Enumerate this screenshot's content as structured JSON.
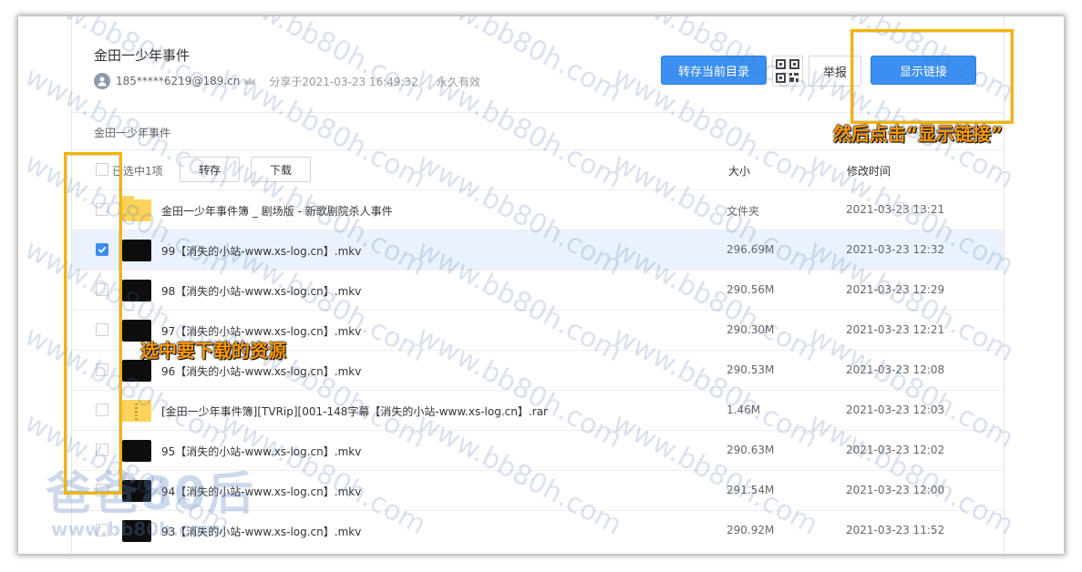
{
  "share": {
    "title": "金田一少年事件",
    "user": "185*****6219@189.cn",
    "shared_at": "分享于2021-03-23 16:49:32",
    "expire": "永久有效"
  },
  "actions": {
    "save_label": "转存当前目录",
    "report_label": "举报",
    "show_link_label": "显示链接"
  },
  "breadcrumb": "金田一少年事件",
  "table": {
    "selected_count": "已选中1项",
    "save_btn": "转存",
    "download_btn": "下载",
    "col_size": "大小",
    "col_time": "修改时间"
  },
  "rows": [
    {
      "type": "folder",
      "name": "金田一少年事件簿 _ 剧场版 - 新歌剧院杀人事件",
      "size": "文件夹",
      "time": "2021-03-23 13:21",
      "checked": false
    },
    {
      "type": "video",
      "name": "99【消失的小站-www.xs-log.cn】.mkv",
      "size": "296.69M",
      "time": "2021-03-23 12:32",
      "checked": true
    },
    {
      "type": "video",
      "name": "98【消失的小站-www.xs-log.cn】.mkv",
      "size": "290.56M",
      "time": "2021-03-23 12:29",
      "checked": false
    },
    {
      "type": "video",
      "name": "97【消失的小站-www.xs-log.cn】.mkv",
      "size": "290.30M",
      "time": "2021-03-23 12:21",
      "checked": false
    },
    {
      "type": "video",
      "name": "96【消失的小站-www.xs-log.cn】.mkv",
      "size": "290.53M",
      "time": "2021-03-23 12:08",
      "checked": false
    },
    {
      "type": "zip",
      "name": "[金田一少年事件簿][TVRip][001-148字幕【消失的小站-www.xs-log.cn】.rar",
      "size": "1.46M",
      "time": "2021-03-23 12:03",
      "checked": false
    },
    {
      "type": "video",
      "name": "95【消失的小站-www.xs-log.cn】.mkv",
      "size": "290.63M",
      "time": "2021-03-23 12:02",
      "checked": false
    },
    {
      "type": "video",
      "name": "94【消失的小站-www.xs-log.cn】.mkv",
      "size": "291.54M",
      "time": "2021-03-23 12:00",
      "checked": false
    },
    {
      "type": "video",
      "name": "93【消失的小站-www.xs-log.cn】.mkv",
      "size": "290.92M",
      "time": "2021-03-23 11:52",
      "checked": false
    }
  ],
  "annotations": {
    "show_link": "然后点击“显示链接”",
    "select": "选中要下载的资源"
  },
  "watermark": {
    "text": "www.bb80h.com",
    "logo": "爸爸80后",
    "logo_sub": "www.bb80h.com"
  },
  "colors": {
    "primary": "#3b8ff0",
    "highlight": "#f3b400",
    "annotation": "#ff9a00",
    "selected_row": "#eaf3fd"
  }
}
